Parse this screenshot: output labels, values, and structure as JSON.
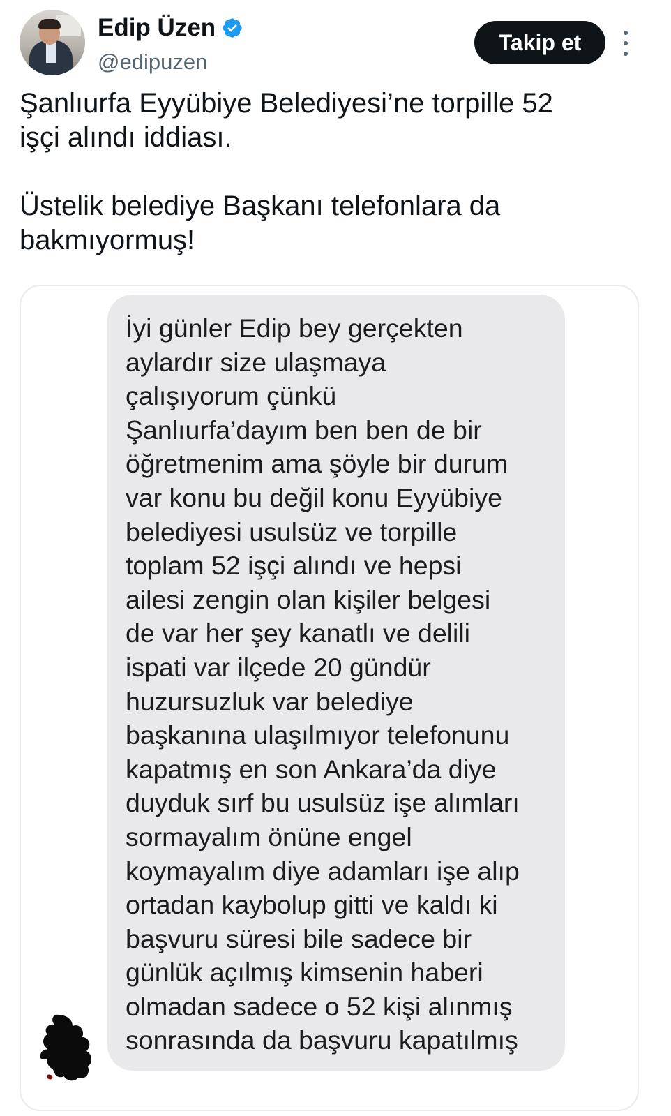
{
  "author": {
    "display_name": "Edip Üzen",
    "handle": "@edipuzen",
    "verified": true,
    "verified_badge_color": "#1d9bf0",
    "avatar_icon": "profile-photo"
  },
  "actions": {
    "follow_label": "Takip et",
    "more_icon": "more-vertical-icon"
  },
  "tweet": {
    "paragraphs": [
      "Şanlıurfa Eyyübiye Belediyesi’ne torpille 52\nişçi alındı iddiası.",
      "Üstelik belediye Başkanı telefonlara da\nbakmıyormuş!"
    ]
  },
  "media": {
    "message_text": "İyi günler Edip bey gerçekten\naylardır size ulaşmaya\nçalışıyorum çünkü\nŞanlıurfa’dayım ben ben de bir\nöğretmenim ama şöyle bir durum\nvar konu bu değil konu Eyyübiye\nbelediyesi usulsüz ve torpille\ntoplam 52 işçi alındı ve hepsi\nailesi zengin olan kişiler belgesi\nde var her şey kanatlı ve delili\nispati var ilçede 20 gündür\nhuzursuzluk var belediye\nbaşkanına ulaşılmıyor telefonunu\nkapatmış en son Ankara’da diye\nduyduk sırf bu usulsüz işe alımları\nsormayalım önüne engel\nkoymayalım diye adamları işe alıp\nortadan kaybolup gitti ve kaldı ki\nbaşvuru süresi bile sadece bir\ngünlük açılmış kimsenin haberi\nolmadan sadece o 52 kişi alınmış\nsonrasında da başvuru kapatılmış",
    "bubble_color": "#e9e9eb",
    "redaction_icon": "redacted-avatar-scribble"
  },
  "colors": {
    "text_primary": "#0f1419",
    "text_secondary": "#536471",
    "button_bg": "#0f1419",
    "button_text": "#ffffff",
    "card_border": "#e6ecf0"
  }
}
